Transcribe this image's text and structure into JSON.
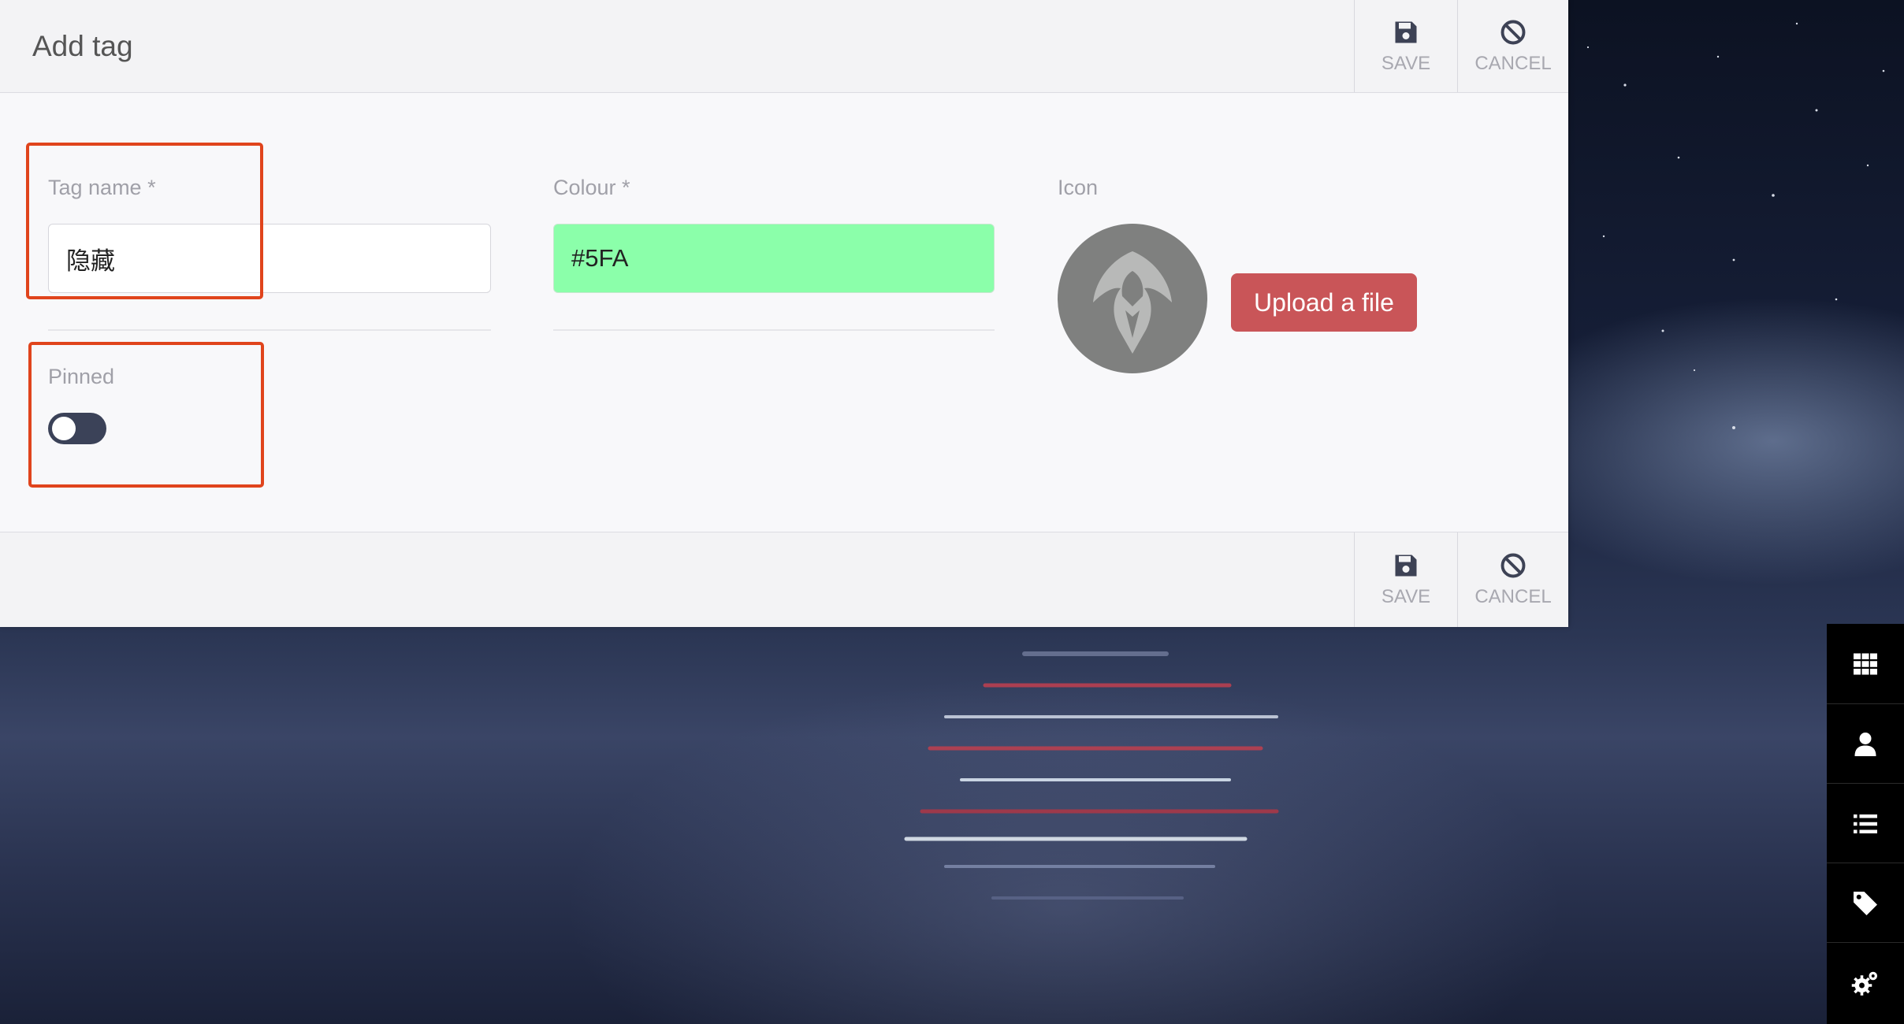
{
  "header": {
    "title": "Add tag",
    "save_label": "SAVE",
    "cancel_label": "CANCEL"
  },
  "form": {
    "tag_name": {
      "label": "Tag name *",
      "value": "隐藏"
    },
    "colour": {
      "label": "Colour *",
      "value": "#5FA",
      "swatch": "#8bffaa"
    },
    "icon": {
      "label": "Icon",
      "upload_label": "Upload a file"
    },
    "pinned": {
      "label": "Pinned",
      "on": false
    }
  },
  "footer": {
    "save_label": "SAVE",
    "cancel_label": "CANCEL"
  },
  "dock": {
    "items": [
      "grid-icon",
      "user-icon",
      "list-icon",
      "tag-icon",
      "cogs-icon"
    ]
  },
  "colors": {
    "accent": "#c95558",
    "highlight": "#e0441c",
    "toggle": "#3b4258"
  }
}
